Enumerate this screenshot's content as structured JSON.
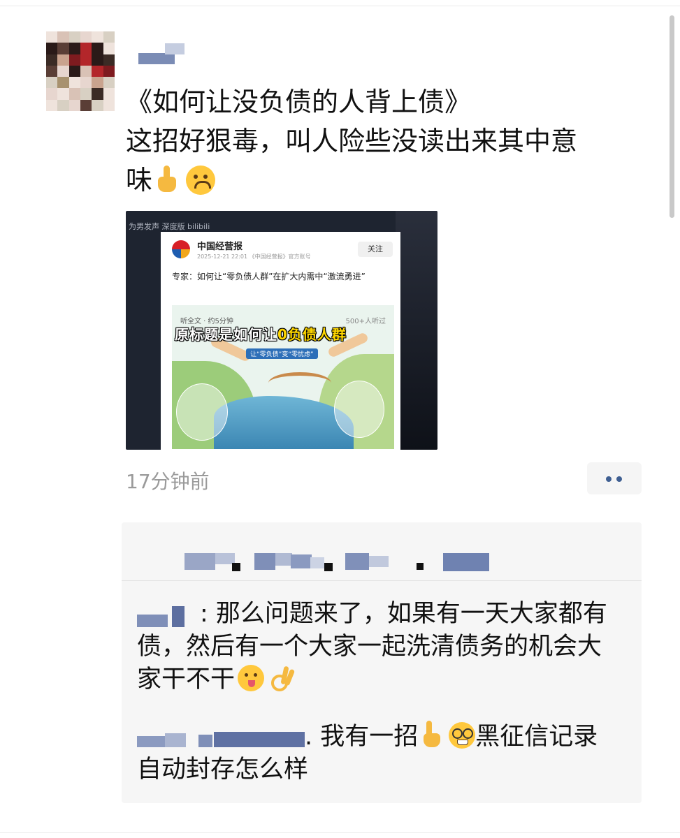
{
  "post": {
    "text_lines": [
      "《如何让没负债的人背上债》",
      "这招好狠毒，叫人险些没读出来其中意",
      "味"
    ],
    "emoji_names": [
      "middle-finger-icon",
      "upside-down-face-icon"
    ],
    "time": "17分钟前",
    "more_button": "more-options-icon"
  },
  "shared_image": {
    "watermark": "为男发声 深度版 bilibili",
    "publisher": "中国经营报",
    "meta": "2025-12-21 22:01 《中国经营报》官方账号",
    "follow_label": "关注",
    "headline": "专家：如何让“零负债人群”在扩大内需中“激流勇进”",
    "listen_text": "听全文 · 约5分钟",
    "listen_count": "500+人听过",
    "overlay_title_prefix": "原标题是如何让",
    "overlay_title_highlight": "0负债人群",
    "overlay_subtitle": "让“零负债”变“零忧虑”"
  },
  "comments": [
    {
      "text_lines": [
        ": 那么问题来了，如果有一天大家都有",
        "债，然后有一个大家一起洗清债务的机会大",
        "家干不干"
      ],
      "emoji_names": [
        "face-savoring-food-icon",
        "ok-hand-icon"
      ]
    },
    {
      "text_lines": [
        ". 我有一招",
        "黑征信记录",
        "自动封存怎么样"
      ],
      "emoji_names": [
        "pointing-up-icon",
        "nerd-face-icon"
      ]
    }
  ],
  "colors": {
    "link_blue": "#3f5f92",
    "time_gray": "#9a9a9a",
    "comment_bg": "#f6f6f6"
  }
}
